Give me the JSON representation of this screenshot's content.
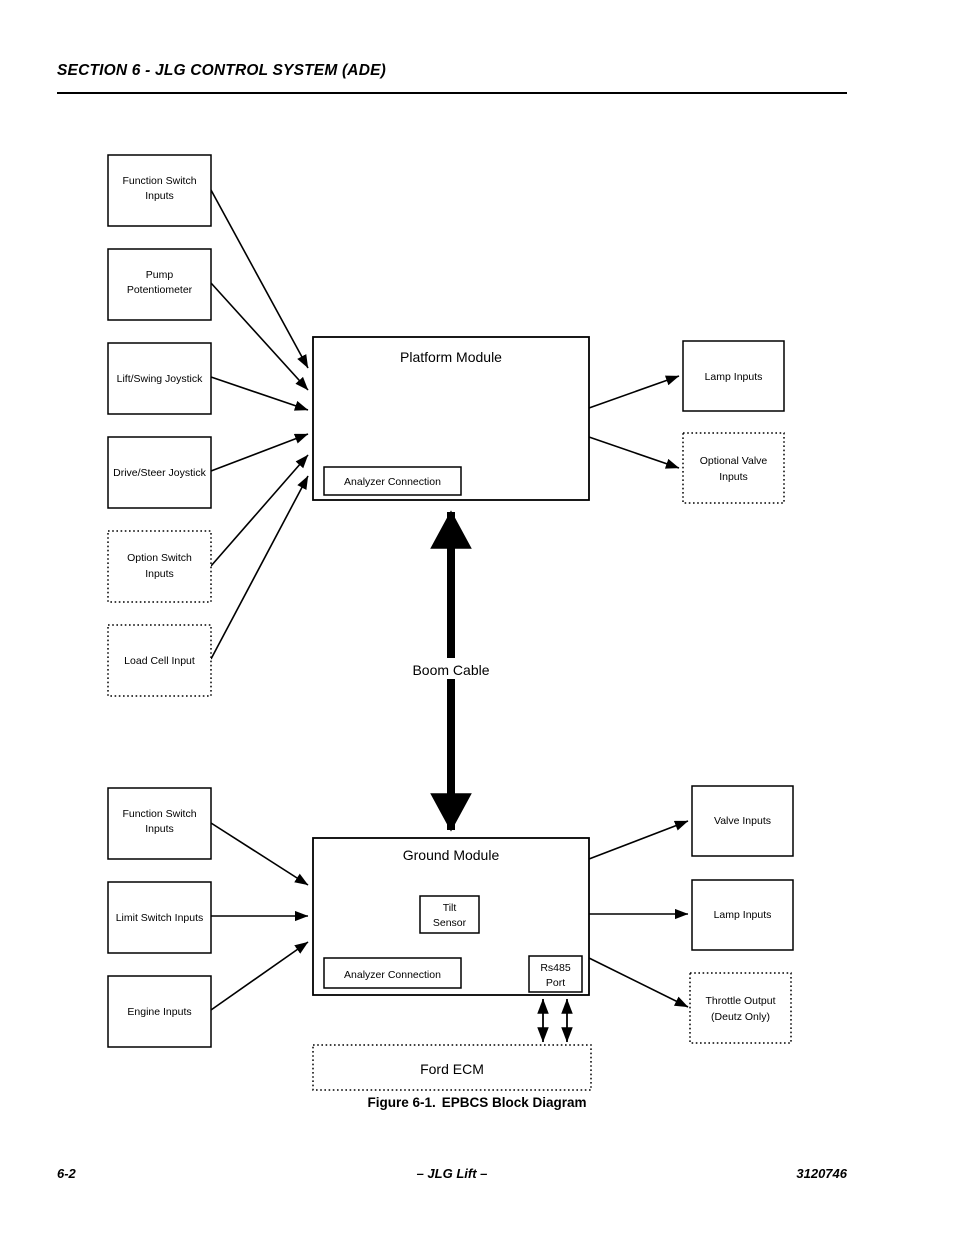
{
  "header": {
    "title": "SECTION 6 - JLG CONTROL SYSTEM (ADE)"
  },
  "figure": {
    "number": "Figure 6-1.",
    "title": "EPBCS Block Diagram"
  },
  "footer": {
    "page": "6-2",
    "center": "– JLG Lift –",
    "document_number": "3120746"
  },
  "diagram": {
    "platform_section": {
      "module": {
        "title": "Platform Module",
        "sub_blocks": [
          {
            "label": "Analyzer Connection"
          }
        ]
      },
      "inputs": [
        {
          "label_line1": "Function Switch",
          "label_line2": "Inputs",
          "border": "solid"
        },
        {
          "label_line1": "Pump",
          "label_line2": "Potentiometer",
          "border": "solid"
        },
        {
          "label_line1": "Lift/Swing Joystick",
          "label_line2": "",
          "border": "solid"
        },
        {
          "label_line1": "Drive/Steer Joystick",
          "label_line2": "",
          "border": "solid"
        },
        {
          "label_line1": "Option Switch",
          "label_line2": "Inputs",
          "border": "dotted"
        },
        {
          "label_line1": "Load Cell Input",
          "label_line2": "",
          "border": "dotted"
        }
      ],
      "outputs": [
        {
          "label_line1": "Lamp Inputs",
          "label_line2": "",
          "border": "solid"
        },
        {
          "label_line1": "Optional Valve",
          "label_line2": "Inputs",
          "border": "dotted"
        }
      ]
    },
    "boom_cable": {
      "label": "Boom Cable"
    },
    "ground_section": {
      "module": {
        "title": "Ground Module",
        "sub_blocks": [
          {
            "label_line1": "Tilt",
            "label_line2": "Sensor"
          },
          {
            "label_line1": "Analyzer Connection",
            "label_line2": ""
          },
          {
            "label_line1": "Rs485",
            "label_line2": "Port"
          }
        ]
      },
      "inputs": [
        {
          "label_line1": "Function Switch",
          "label_line2": "Inputs",
          "border": "solid"
        },
        {
          "label_line1": "Limit Switch Inputs",
          "label_line2": "",
          "border": "solid"
        },
        {
          "label_line1": "Engine Inputs",
          "label_line2": "",
          "border": "solid"
        }
      ],
      "outputs": [
        {
          "label_line1": "Valve Inputs",
          "label_line2": "",
          "border": "solid"
        },
        {
          "label_line1": "Lamp Inputs",
          "label_line2": "",
          "border": "solid"
        },
        {
          "label_line1": "Throttle Output",
          "label_line2": "(Deutz Only)",
          "border": "dotted"
        }
      ]
    },
    "ecm": {
      "label": "Ford ECM",
      "border": "dotted"
    }
  },
  "colors": {
    "stroke": "#000000",
    "background": "#ffffff"
  }
}
